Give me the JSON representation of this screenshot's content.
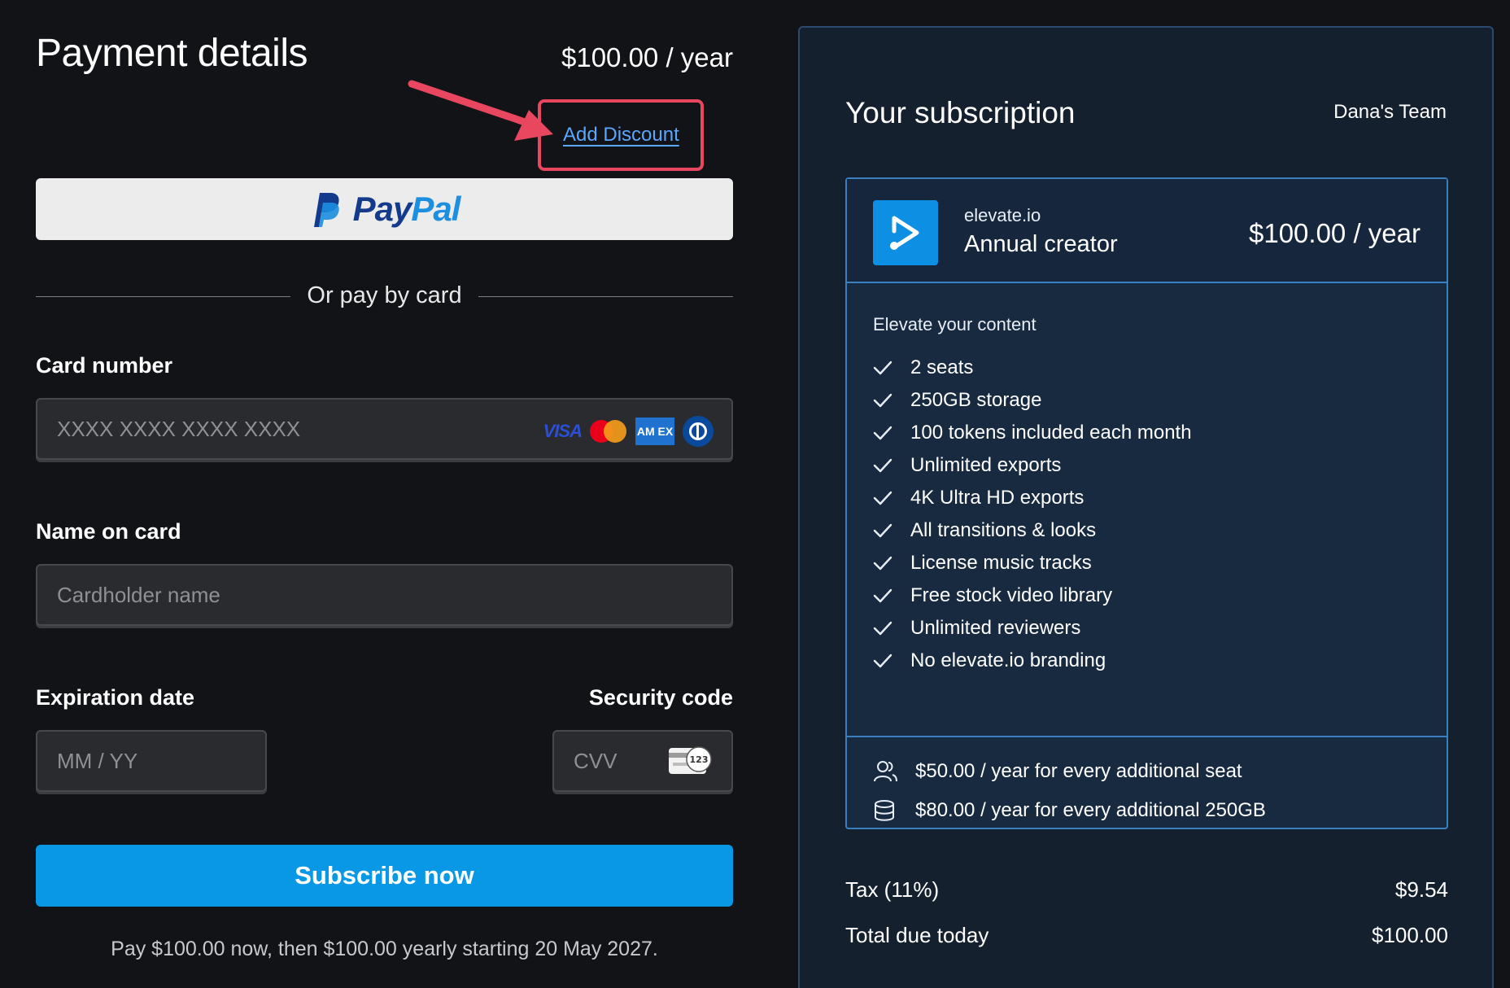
{
  "payment": {
    "title": "Payment details",
    "price": "$100.00 / year",
    "add_discount": "Add Discount",
    "paypal": {
      "pay": "Pay",
      "pal": "Pal"
    },
    "divider_text": "Or pay by card",
    "card_number": {
      "label": "Card number",
      "placeholder": "XXXX XXXX XXXX XXXX",
      "brands": [
        "VISA",
        "AM EX"
      ]
    },
    "name_on_card": {
      "label": "Name on card",
      "placeholder": "Cardholder name"
    },
    "expiration": {
      "label": "Expiration date",
      "placeholder": "MM / YY"
    },
    "security": {
      "label": "Security code",
      "placeholder": "CVV",
      "icon_text": "123"
    },
    "subscribe_label": "Subscribe now",
    "footnote": "Pay $100.00 now, then $100.00 yearly starting 20 May 2027."
  },
  "subscription": {
    "title": "Your subscription",
    "team": "Dana's Team",
    "plan": {
      "brand": "elevate.io",
      "name": "Annual creator",
      "price": "$100.00 / year",
      "tagline": "Elevate your content",
      "features": [
        "2 seats",
        "250GB storage",
        "100 tokens included each month",
        "Unlimited exports",
        "4K Ultra HD exports",
        "All transitions & looks",
        "License music tracks",
        "Free stock video library",
        "Unlimited reviewers",
        "No elevate.io branding"
      ],
      "addons": [
        {
          "icon": "users-icon",
          "text": "$50.00 / year for every additional seat"
        },
        {
          "icon": "database-icon",
          "text": "$80.00 / year for every additional 250GB"
        }
      ]
    },
    "tax": {
      "label": "Tax (11%)",
      "value": "$9.54"
    },
    "total": {
      "label": "Total due today",
      "value": "$100.00"
    }
  },
  "colors": {
    "background": "#121316",
    "accent": "#0898e6",
    "highlight": "#e8475f",
    "panel": "#15202f"
  }
}
